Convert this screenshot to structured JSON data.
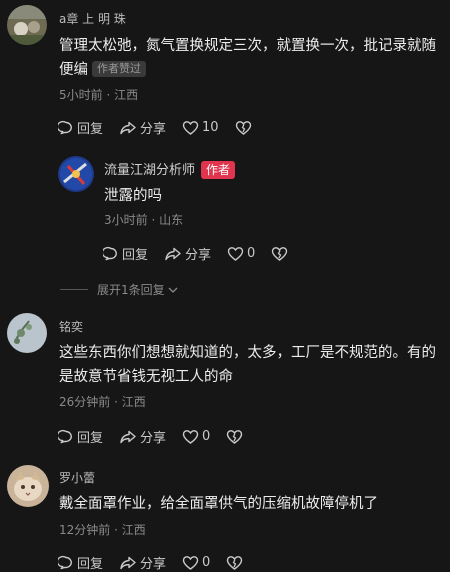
{
  "comments": [
    {
      "username": "a章 上 明 珠",
      "content": "管理太松弛，氮气置换规定三次，就置换一次，批记录就随便编",
      "badge": "作者赞过",
      "meta": "5小时前 · 江西",
      "reply_label": "回复",
      "share_label": "分享",
      "like_count": "10"
    },
    {
      "username": "流量江湖分析师",
      "badge": "作者",
      "content": "泄露的吗",
      "meta": "3小时前 · 山东",
      "reply_label": "回复",
      "share_label": "分享",
      "like_count": "0"
    },
    {
      "username": "铭奕",
      "content": "这些东西你们想想就知道的，太多，工厂是不规范的。有的是故意节省钱无视工人的命",
      "meta": "26分钟前 · 江西",
      "reply_label": "回复",
      "share_label": "分享",
      "like_count": "0"
    },
    {
      "username": "罗小蕾",
      "content": "戴全面罩作业，给全面罩供气的压缩机故障停机了",
      "meta": "12分钟前 · 江西",
      "reply_label": "回复",
      "share_label": "分享",
      "like_count": "0"
    }
  ],
  "expand_replies": "展开1条回复",
  "colors": {
    "author_badge": "#e0344f",
    "background": "#161616"
  },
  "icons": [
    "reply-icon",
    "share-icon",
    "heart-icon",
    "broken-heart-icon",
    "chevron-down-icon"
  ]
}
